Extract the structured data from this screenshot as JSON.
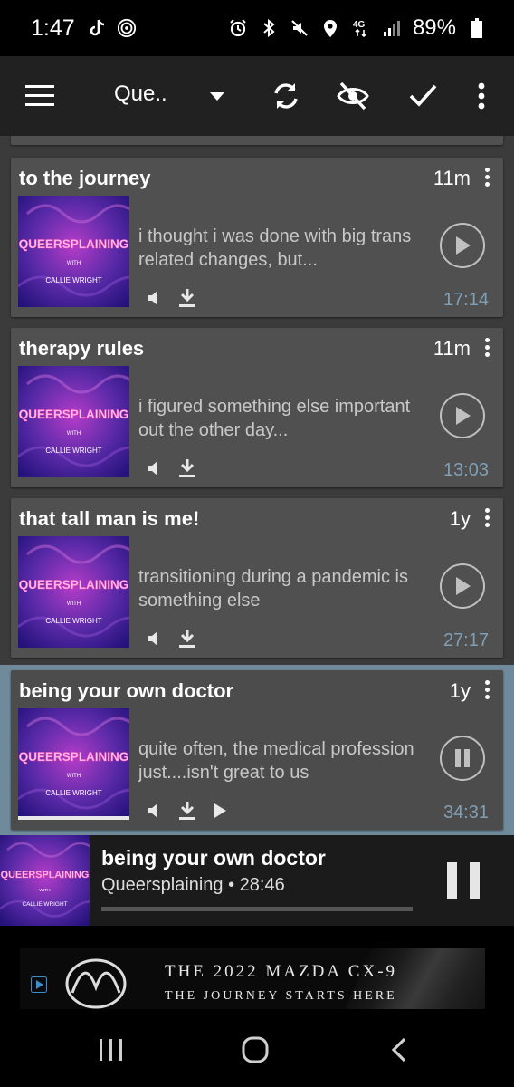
{
  "status_bar": {
    "time": "1:47",
    "battery": "89%",
    "left_icons": [
      "tiktok-icon",
      "hotspot-icon"
    ],
    "right_icons": [
      "alarm-icon",
      "bluetooth-icon",
      "mute-icon",
      "location-icon",
      "4g-icon",
      "signal-icon",
      "battery-icon"
    ]
  },
  "toolbar": {
    "title": "Que..",
    "actions": [
      "refresh-icon",
      "hide-icon",
      "check-icon",
      "more-icon"
    ]
  },
  "episodes": [
    {
      "title": "to the journey",
      "age": "11m",
      "description": "i thought i was done with big trans related changes, but...",
      "duration": "17:14",
      "state": "play"
    },
    {
      "title": "therapy rules",
      "age": "11m",
      "description": "i figured something else important out the other day...",
      "duration": "13:03",
      "state": "play"
    },
    {
      "title": "that tall man is me!",
      "age": "1y",
      "description": "transitioning during a pandemic is something else",
      "duration": "27:17",
      "state": "play"
    },
    {
      "title": "being your own doctor",
      "age": "1y",
      "description": "quite often, the medical profession just....isn't great to us",
      "duration": "34:31",
      "state": "pause"
    }
  ],
  "art": {
    "name": "QUEERSPLAINING",
    "with": "WITH",
    "host": "CALLIE WRIGHT"
  },
  "mini_player": {
    "title": "being your own doctor",
    "subtitle": "Queersplaining • 28:46",
    "progress": 0.0
  },
  "ad": {
    "line1": "THE 2022 MAZDA CX-9",
    "line2": "THE JOURNEY STARTS HERE"
  },
  "colors": {
    "accent_duration": "#7f9fb5",
    "playing_highlight": "#6f8a9a",
    "card_bg": "#505050",
    "toolbar_bg": "#212121"
  }
}
